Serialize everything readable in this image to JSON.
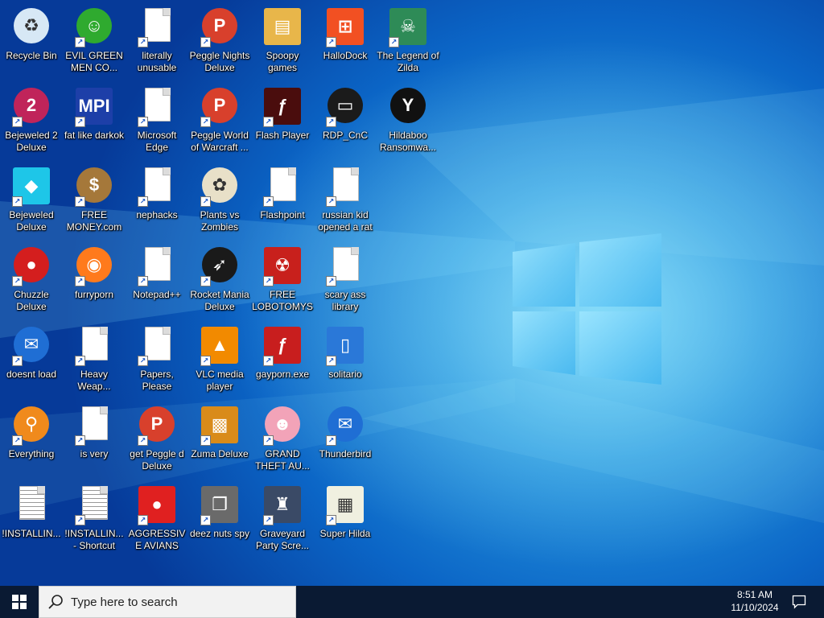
{
  "desktop": {
    "icons": [
      {
        "label": "Recycle Bin",
        "icon": "recycle-bin-icon",
        "shortcut": false,
        "style": "round",
        "glyph": "♻",
        "color": "#d7e8f5"
      },
      {
        "label": "EVIL GREEN MEN CO...",
        "icon": "messenger-buddies-icon",
        "shortcut": true,
        "style": "round",
        "glyph": "☺",
        "color": "#2faa2f"
      },
      {
        "label": "literally unusable",
        "icon": "blank-document-icon",
        "shortcut": true,
        "style": "doc",
        "glyph": "",
        "color": "#ffffff"
      },
      {
        "label": "Peggle Nights Deluxe",
        "icon": "peggle-icon",
        "shortcut": true,
        "style": "round",
        "glyph": "P",
        "color": "#d8402c"
      },
      {
        "label": "Spoopy games",
        "icon": "folder-icon",
        "shortcut": false,
        "style": "square",
        "glyph": "▤",
        "color": "#e8b64a"
      },
      {
        "label": "HalloDock",
        "icon": "windows-flag-icon",
        "shortcut": true,
        "style": "square",
        "glyph": "⊞",
        "color": "#f25022"
      },
      {
        "label": "The Legend of Zilda",
        "icon": "pixel-hero-icon",
        "shortcut": true,
        "style": "square",
        "glyph": "☠",
        "color": "#2e8b57"
      },
      {
        "label": "Bejeweled 2 Deluxe",
        "icon": "bejeweled-2-icon",
        "shortcut": true,
        "style": "round",
        "glyph": "2",
        "color": "#c0245a"
      },
      {
        "label": "fat like darkok",
        "icon": "mpi-logo-icon",
        "shortcut": true,
        "style": "square",
        "glyph": "MPI",
        "color": "#1d3fa8"
      },
      {
        "label": "Microsoft Edge",
        "icon": "blank-document-icon",
        "shortcut": true,
        "style": "doc",
        "glyph": "",
        "color": "#ffffff"
      },
      {
        "label": "Peggle World of Warcraft ...",
        "icon": "peggle-icon",
        "shortcut": true,
        "style": "round",
        "glyph": "P",
        "color": "#d8402c"
      },
      {
        "label": "Flash Player",
        "icon": "flash-icon",
        "shortcut": true,
        "style": "square",
        "glyph": "ƒ",
        "color": "#4a0d0d"
      },
      {
        "label": "RDP_CnC",
        "icon": "remote-desktop-icon",
        "shortcut": true,
        "style": "round",
        "glyph": "▭",
        "color": "#1b1b1b"
      },
      {
        "label": "Hildaboo Ransomwa...",
        "icon": "yashma-ransomware-icon",
        "shortcut": false,
        "style": "round",
        "glyph": "Y",
        "color": "#111111"
      },
      {
        "label": "Bejeweled Deluxe",
        "icon": "diamond-gem-icon",
        "shortcut": true,
        "style": "square",
        "glyph": "◆",
        "color": "#1ec6e8"
      },
      {
        "label": "FREE MONEY.com",
        "icon": "money-bag-icon",
        "shortcut": true,
        "style": "round",
        "glyph": "$",
        "color": "#a5783a"
      },
      {
        "label": "nephacks",
        "icon": "blank-document-icon",
        "shortcut": true,
        "style": "doc",
        "glyph": "",
        "color": "#ffffff"
      },
      {
        "label": "Plants vs Zombies",
        "icon": "plants-vs-zombies-icon",
        "shortcut": true,
        "style": "round",
        "glyph": "✿",
        "color": "#e8e0c8"
      },
      {
        "label": "Flashpoint",
        "icon": "blank-document-icon",
        "shortcut": true,
        "style": "doc",
        "glyph": "",
        "color": "#ffffff"
      },
      {
        "label": "russian kid opened a rat",
        "icon": "blank-document-icon",
        "shortcut": true,
        "style": "doc",
        "glyph": "",
        "color": "#ffffff"
      },
      {
        "label": "Chuzzle Deluxe",
        "icon": "chuzzle-icon",
        "shortcut": true,
        "style": "round",
        "glyph": "●",
        "color": "#d41e1e"
      },
      {
        "label": "furryporn",
        "icon": "firefox-icon",
        "shortcut": true,
        "style": "round",
        "glyph": "◉",
        "color": "#ff7a1c"
      },
      {
        "label": "Notepad++",
        "icon": "blank-document-icon",
        "shortcut": true,
        "style": "doc",
        "glyph": "",
        "color": "#ffffff"
      },
      {
        "label": "Rocket Mania Deluxe",
        "icon": "rocket-mania-icon",
        "shortcut": true,
        "style": "round",
        "glyph": "➶",
        "color": "#1a1a1a"
      },
      {
        "label": "FREE LOBOTOMYS",
        "icon": "lobotomy-red-icon",
        "shortcut": true,
        "style": "square",
        "glyph": "☢",
        "color": "#c8201c"
      },
      {
        "label": "scary ass library",
        "icon": "blank-document-icon",
        "shortcut": true,
        "style": "doc",
        "glyph": "",
        "color": "#ffffff"
      },
      {
        "label": "doesnt load",
        "icon": "thunderbird-icon",
        "shortcut": true,
        "style": "round",
        "glyph": "✉",
        "color": "#1f6ed4"
      },
      {
        "label": "Heavy Weap...",
        "icon": "blank-document-icon",
        "shortcut": true,
        "style": "doc",
        "glyph": "",
        "color": "#ffffff"
      },
      {
        "label": "Papers, Please",
        "icon": "blank-document-icon",
        "shortcut": true,
        "style": "doc",
        "glyph": "",
        "color": "#ffffff"
      },
      {
        "label": "VLC media player",
        "icon": "vlc-cone-icon",
        "shortcut": true,
        "style": "square",
        "glyph": "▲",
        "color": "#f28a00"
      },
      {
        "label": "gayporn.exe",
        "icon": "flash-icon",
        "shortcut": true,
        "style": "square",
        "glyph": "ƒ",
        "color": "#c81e1e"
      },
      {
        "label": "solitario",
        "icon": "solitaire-icon",
        "shortcut": true,
        "style": "square",
        "glyph": "▯",
        "color": "#2a78d8"
      },
      {
        "label": "Everything",
        "icon": "everything-search-icon",
        "shortcut": true,
        "style": "round",
        "glyph": "⚲",
        "color": "#f08a1c"
      },
      {
        "label": "is very",
        "icon": "blank-document-icon",
        "shortcut": true,
        "style": "doc",
        "glyph": "",
        "color": "#ffffff"
      },
      {
        "label": "get Peggle d Deluxe",
        "icon": "peggle-icon",
        "shortcut": true,
        "style": "round",
        "glyph": "P",
        "color": "#d8402c"
      },
      {
        "label": "Zuma Deluxe",
        "icon": "zuma-idol-icon",
        "shortcut": true,
        "style": "square",
        "glyph": "▩",
        "color": "#d98b1a"
      },
      {
        "label": "GRAND THEFT AU...",
        "icon": "anime-girl-icon",
        "shortcut": true,
        "style": "round",
        "glyph": "☻",
        "color": "#f2a3b8"
      },
      {
        "label": "Thunderbird",
        "icon": "thunderbird-icon",
        "shortcut": true,
        "style": "round",
        "glyph": "✉",
        "color": "#1f6ed4"
      },
      {
        "label": "!INSTALLIN...",
        "icon": "text-file-icon",
        "shortcut": false,
        "style": "doc lined",
        "glyph": "",
        "color": "#ffffff"
      },
      {
        "label": "!INSTALLIN... - Shortcut",
        "icon": "text-file-icon",
        "shortcut": true,
        "style": "doc lined",
        "glyph": "",
        "color": "#ffffff"
      },
      {
        "label": "AGGRESSIVE AVIANS",
        "icon": "angry-bird-icon",
        "shortcut": true,
        "style": "square",
        "glyph": "●",
        "color": "#e02020"
      },
      {
        "label": "deez nuts spy",
        "icon": "stacked-windows-icon",
        "shortcut": true,
        "style": "square",
        "glyph": "❐",
        "color": "#6a6a6a"
      },
      {
        "label": "Graveyard Party Scre...",
        "icon": "graveyard-castle-icon",
        "shortcut": true,
        "style": "square",
        "glyph": "♜",
        "color": "#3a4a66"
      },
      {
        "label": "Super Hilda",
        "icon": "pixel-cat-icon",
        "shortcut": true,
        "style": "square",
        "glyph": "▦",
        "color": "#f0f0e0"
      }
    ]
  },
  "taskbar": {
    "search_placeholder": "Type here to search",
    "time": "8:51 AM",
    "date": "11/10/2024"
  },
  "colors": {
    "taskbar_bg": "#0a1a33",
    "wallpaper_accent": "#5cc8f2"
  }
}
